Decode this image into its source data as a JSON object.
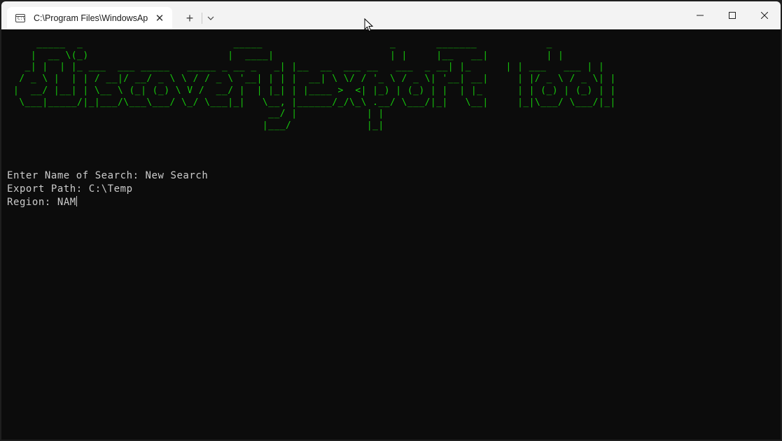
{
  "window": {
    "tab_title": "C:\\Program Files\\WindowsAp",
    "tab_icon": "terminal-icon",
    "new_tab_glyph": "+",
    "close_tab_glyph": "✕",
    "controls": [
      "minimize-icon",
      "maximize-icon",
      "close-icon"
    ]
  },
  "terminal": {
    "banner_text": "    _____  _                          _____                      _       _______            _\n   |  __ \\(_)                        |  ____|                    | |     |__   __|          | |\n  _| |  | |_ ___  ___ _____   _____ _ __ _   _| |__  __  ___ __   ___  _ __| |_      | | ___   ___ | |\n / _ \\ |  | | / __|/ __/ _ \\ \\ / / _ \\ '__| | | |  __| \\ \\/ / '_ \\ / _ \\| '__| __|     | |/ _ \\ / _ \\| |\n|  __/ |__| | \\__ \\ (_| (_) \\ V /  __/ |  | |_| | |____ >  <| |_) | (_) | |  | |_      | | (_) | (_) | |\n \\___|_____/|_|___/\\___\\___/ \\_/ \\___|_|   \\__, |______/_/\\_\\ .__/ \\___/|_|   \\__|     |_|\\___/ \\___/|_|\n                                            __/ |            | |\n                                           |___/             |_|",
    "banner_color": "#16c60c",
    "lines": [
      {
        "label": "Enter Name of Search: ",
        "value": "New Search"
      },
      {
        "label": "Export Path: ",
        "value": "C:\\Temp"
      },
      {
        "label": "Region: ",
        "value": "NAM"
      }
    ],
    "text_color": "#cccccc",
    "background": "#0c0c0c"
  }
}
